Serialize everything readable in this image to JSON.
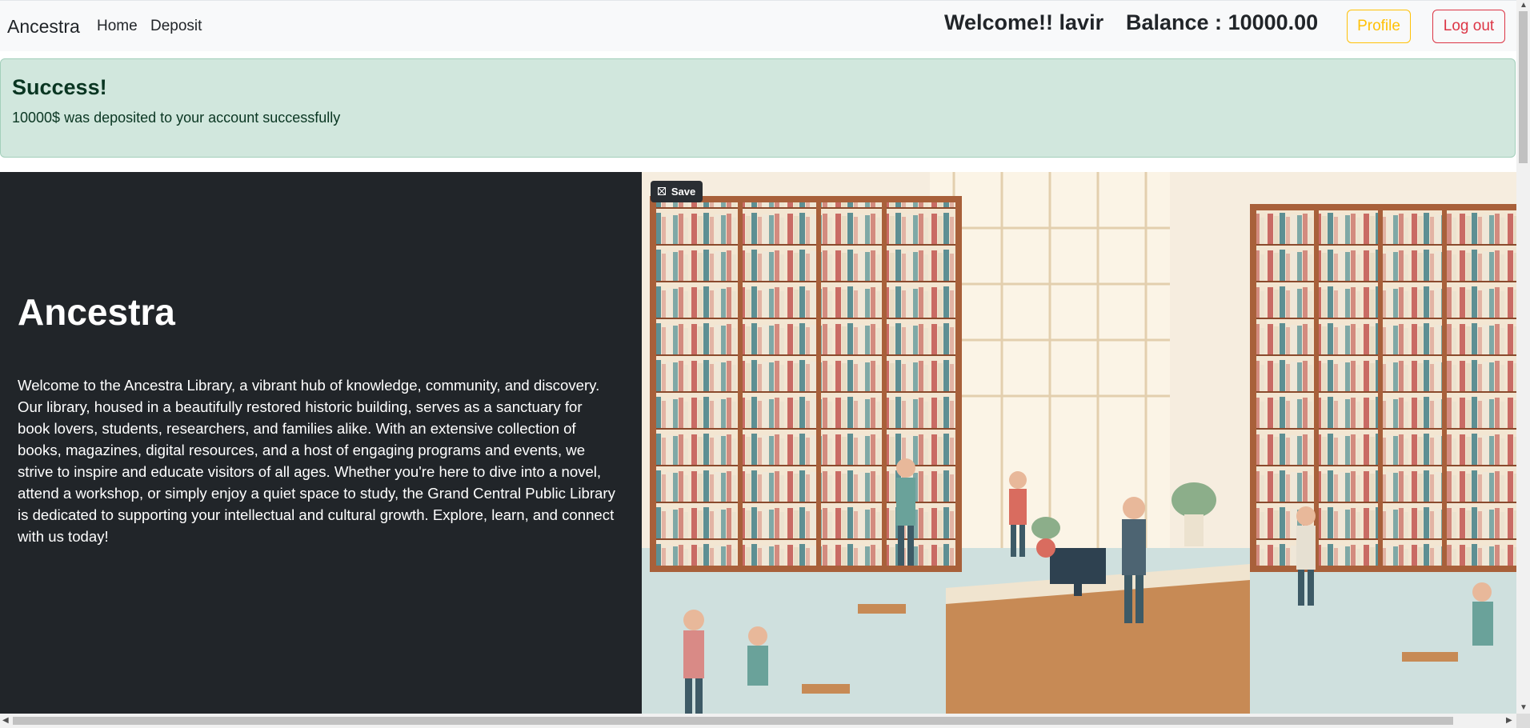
{
  "navbar": {
    "brand": "Ancestra",
    "links": [
      "Home",
      "Deposit"
    ],
    "welcome": "Welcome!! lavir",
    "balance_label": "Balance :",
    "balance_value": "10000.00",
    "profile_label": "Profile",
    "logout_label": "Log out"
  },
  "alert": {
    "title": "Success!",
    "message": "10000$ was deposited to your account successfully"
  },
  "hero": {
    "title": "Ancestra",
    "description": "Welcome to the Ancestra Library, a vibrant hub of knowledge, community, and discovery. Our library, housed in a beautifully restored historic building, serves as a sanctuary for book lovers, students, researchers, and families alike. With an extensive collection of books, magazines, digital resources, and a host of engaging programs and events, we strive to inspire and educate visitors of all ages. Whether you're here to dive into a novel, attend a workshop, or simply enjoy a quiet space to study, the Grand Central Public Library is dedicated to supporting your intellectual and cultural growth. Explore, learn, and connect with us today!",
    "save_label": "Save",
    "save_icon": "save-icon",
    "image_icon": "library-illustration"
  },
  "colors": {
    "navbar_bg": "#f8f9fa",
    "alert_bg": "#d1e7dd",
    "hero_bg": "#212529",
    "warning": "#ffc107",
    "danger": "#dc3545"
  }
}
